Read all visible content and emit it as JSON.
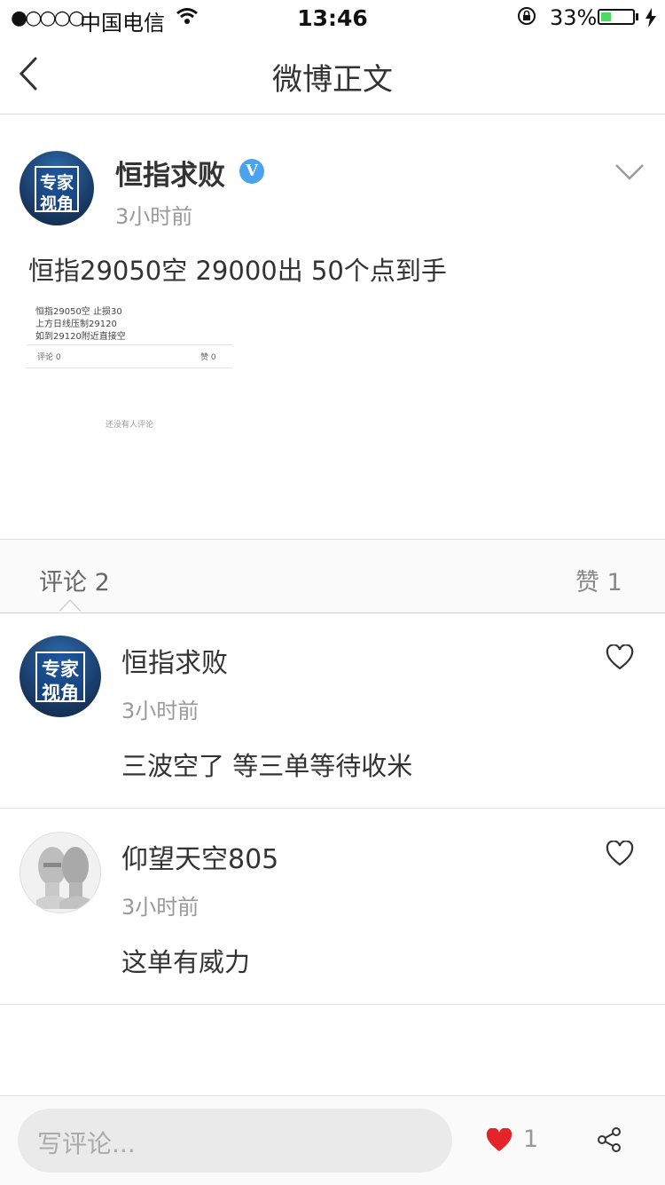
{
  "status": {
    "carrier": "中国电信",
    "time": "13:46",
    "battery": "33%",
    "battery_level": 0.33
  },
  "nav": {
    "title": "微博正文"
  },
  "post": {
    "author": "恒指求败",
    "time": "3小时前",
    "text": "恒指29050空 29000出 50个点到手",
    "avatar_text": [
      "专家",
      "视角"
    ],
    "embedded": {
      "lines": [
        "恒指29050空  止损30",
        "上方日线压制29120",
        "如到29120附近直接空"
      ],
      "comments": "评论 0",
      "likes": "赞 0",
      "empty": "还没有人评论"
    }
  },
  "tabs": {
    "comments": "评论 2",
    "likes": "赞 1"
  },
  "comments": [
    {
      "name": "恒指求败",
      "time": "3小时前",
      "text": "三波空了 等三单等待收米"
    },
    {
      "name": "仰望天空805",
      "time": "3小时前",
      "text": "这单有威力"
    }
  ],
  "bottom": {
    "placeholder": "写评论...",
    "like_count": "1"
  },
  "colors": {
    "accent_red": "#e5242a",
    "verified_blue": "#4ba3f0",
    "battery_green": "#4cd964"
  }
}
